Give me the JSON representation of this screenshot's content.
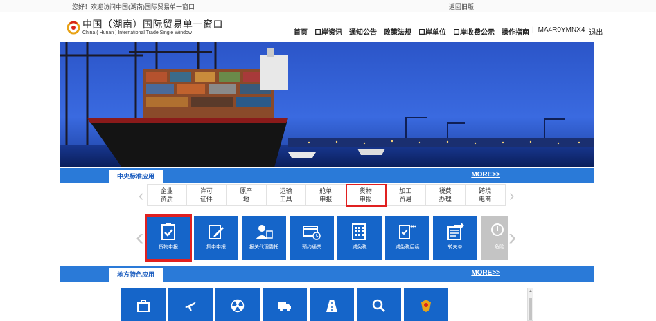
{
  "topbar": {
    "welcome": "您好！欢迎访问中国(湖南)国际贸易单一窗口",
    "old_version": "返回旧版"
  },
  "header": {
    "logo_cn": "中国（湖南）国际贸易单一窗口",
    "logo_en": "China ( Hunan ) International Trade Single Window",
    "nav": [
      "首页",
      "口岸资讯",
      "通知公告",
      "政策法规",
      "口岸单位",
      "口岸收费公示",
      "操作指南"
    ],
    "user": "MA4R0YMNX4",
    "logout": "退出"
  },
  "section1": {
    "title": "中央标准应用",
    "more": "MORE>>"
  },
  "categories": [
    {
      "l1": "企业",
      "l2": "资质"
    },
    {
      "l1": "许可",
      "l2": "证件"
    },
    {
      "l1": "原产",
      "l2": "地"
    },
    {
      "l1": "运输",
      "l2": "工具"
    },
    {
      "l1": "舱单",
      "l2": "申报"
    },
    {
      "l1": "货物",
      "l2": "申报"
    },
    {
      "l1": "加工",
      "l2": "贸易"
    },
    {
      "l1": "税费",
      "l2": "办理"
    },
    {
      "l1": "跨境",
      "l2": "电商"
    }
  ],
  "tiles": [
    "货物申报",
    "集中申报",
    "报关代理委托",
    "预约通关",
    "减免税",
    "减免税后续",
    "转关单",
    "危险"
  ],
  "section2": {
    "title": "地方特色应用",
    "more": "MORE>>"
  },
  "bottom_icons": [
    "briefcase-icon",
    "airplane-icon",
    "radiation-icon",
    "truck-icon",
    "road-icon",
    "magnifier-icon",
    "emblem-icon"
  ],
  "colors": {
    "accent": "#1565c9",
    "bar": "#2a7ad8",
    "highlight": "#e02020"
  }
}
